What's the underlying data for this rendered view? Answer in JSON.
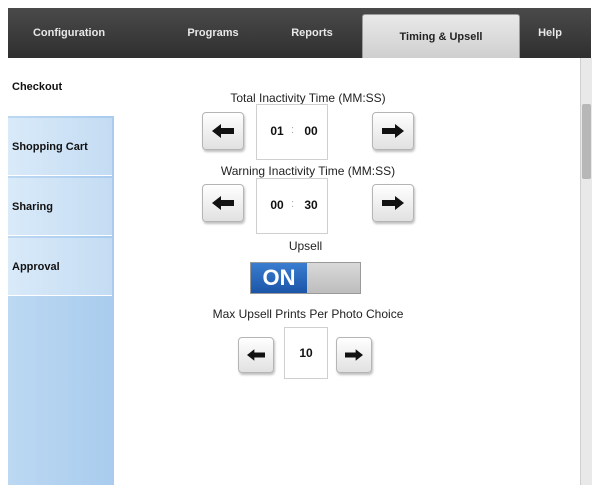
{
  "tabs": [
    {
      "label": "Configuration",
      "active": false
    },
    {
      "label": "Programs",
      "active": false
    },
    {
      "label": "Reports",
      "active": false
    },
    {
      "label": "Timing & Upsell",
      "active": true
    },
    {
      "label": "Help",
      "active": false
    }
  ],
  "sidebar": {
    "items": [
      {
        "label": "Checkout",
        "active": true
      },
      {
        "label": "Shopping Cart",
        "active": false
      },
      {
        "label": "Sharing",
        "active": false
      },
      {
        "label": "Approval",
        "active": false
      }
    ]
  },
  "total_inactivity": {
    "label": "Total Inactivity Time (MM:SS)",
    "minutes": "01",
    "seconds": "00"
  },
  "warning_inactivity": {
    "label": "Warning Inactivity Time (MM:SS)",
    "minutes": "00",
    "seconds": "30"
  },
  "upsell": {
    "label": "Upsell",
    "state": "ON"
  },
  "max_upsell": {
    "label": "Max Upsell Prints Per Photo Choice",
    "value": "10"
  },
  "icons": {
    "decrease": "left-arrow-icon",
    "increase": "right-arrow-icon"
  },
  "colors": {
    "tabbar": "#3a3a3a",
    "sidebar": "#b9d6f1",
    "toggle_on": "#1b55a8"
  }
}
